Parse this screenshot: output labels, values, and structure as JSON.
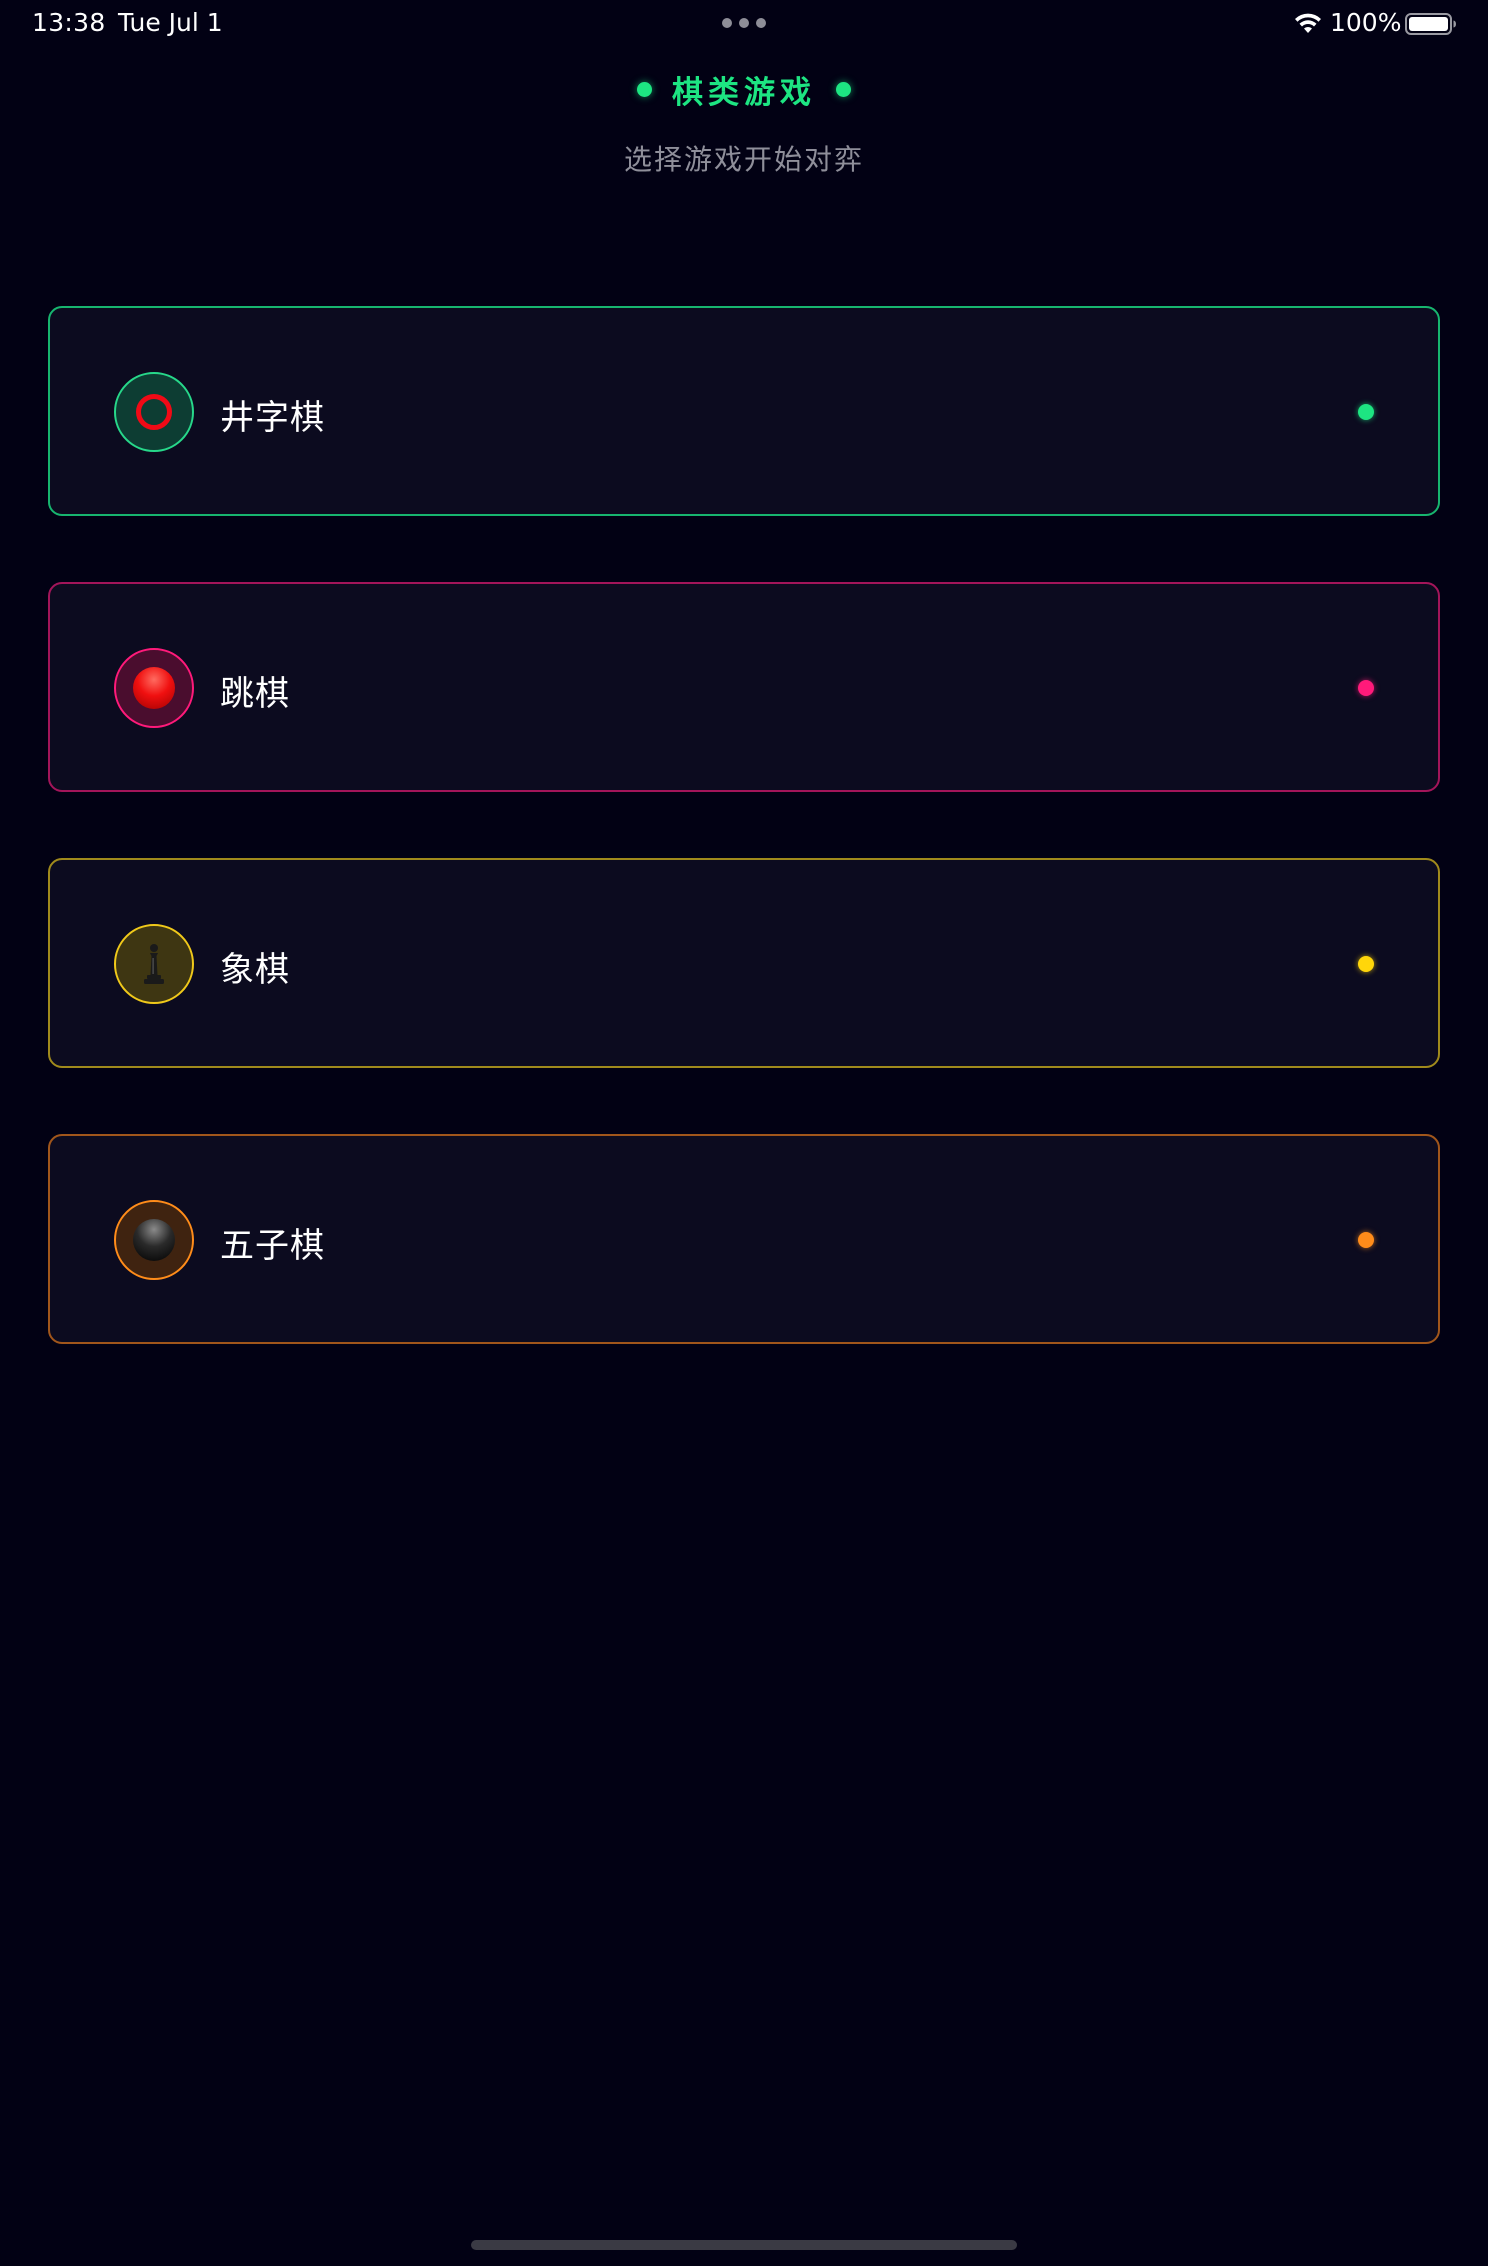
{
  "status_bar": {
    "time": "13:38",
    "date": "Tue Jul 1",
    "battery": "100%",
    "icons": [
      "multitasking-dots",
      "wifi-icon",
      "battery-icon"
    ]
  },
  "header": {
    "title": "棋类游戏",
    "subtitle": "选择游戏开始对弈",
    "accent_color": "#1de582"
  },
  "games": [
    {
      "label": "井字棋",
      "icon": "tic-tac-toe-ring-icon",
      "accent_color": "#17b56f",
      "status_color": "#1de582"
    },
    {
      "label": "跳棋",
      "icon": "red-checker-ball-icon",
      "accent_color": "#a3155a",
      "status_color": "#ff1a7a"
    },
    {
      "label": "象棋",
      "icon": "chess-pawn-icon",
      "accent_color": "#a08a1c",
      "status_color": "#ffd60a"
    },
    {
      "label": "五子棋",
      "icon": "black-go-stone-icon",
      "accent_color": "#a1561b",
      "status_color": "#ff8c1a"
    }
  ],
  "colors": {
    "background": "#020114",
    "card_background": "#0c0b1f",
    "subtitle": "#8f8f9a"
  }
}
